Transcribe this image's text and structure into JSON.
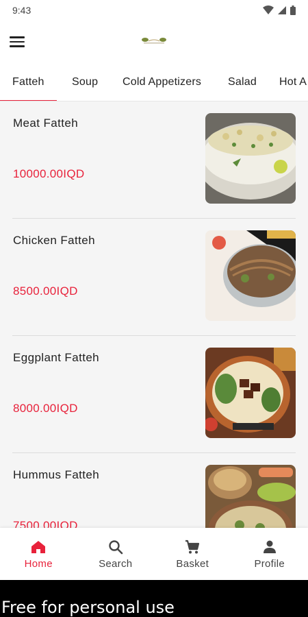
{
  "status_bar": {
    "time": "9:43"
  },
  "tabs": [
    {
      "label": "Fatteh",
      "active": true
    },
    {
      "label": "Soup"
    },
    {
      "label": "Cold Appetizers"
    },
    {
      "label": "Salad"
    },
    {
      "label": "Hot A"
    }
  ],
  "items": [
    {
      "name": "Meat Fatteh",
      "price": "10000.00IQD"
    },
    {
      "name": "Chicken Fatteh",
      "price": "8500.00IQD"
    },
    {
      "name": "Eggplant Fatteh",
      "price": "8000.00IQD"
    },
    {
      "name": "Hummus Fatteh",
      "price": "7500.00IQD"
    }
  ],
  "bottom_nav": [
    {
      "label": "Home",
      "icon": "home-icon",
      "active": true
    },
    {
      "label": "Search",
      "icon": "search-icon"
    },
    {
      "label": "Basket",
      "icon": "cart-icon"
    },
    {
      "label": "Profile",
      "icon": "profile-icon"
    }
  ],
  "footer": {
    "text": "Free for personal use"
  },
  "colors": {
    "accent": "#e8223b",
    "background": "#f5f5f5",
    "text": "#222222"
  }
}
